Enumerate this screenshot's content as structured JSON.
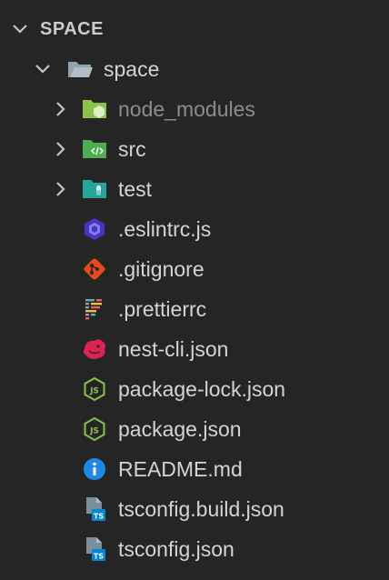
{
  "explorer": {
    "section_title": "SPACE",
    "root_folder": {
      "name": "space",
      "icon": "folder-open-icon",
      "expanded": true
    },
    "items": [
      {
        "name": "node_modules",
        "type": "folder",
        "icon": "nodejs-folder-icon",
        "expanded": false,
        "dimmed": true
      },
      {
        "name": "src",
        "type": "folder",
        "icon": "src-folder-icon",
        "expanded": false,
        "dimmed": false
      },
      {
        "name": "test",
        "type": "folder",
        "icon": "test-folder-icon",
        "expanded": false,
        "dimmed": false
      },
      {
        "name": ".eslintrc.js",
        "type": "file",
        "icon": "eslint-icon"
      },
      {
        "name": ".gitignore",
        "type": "file",
        "icon": "git-icon"
      },
      {
        "name": ".prettierrc",
        "type": "file",
        "icon": "prettier-icon"
      },
      {
        "name": "nest-cli.json",
        "type": "file",
        "icon": "nestjs-icon"
      },
      {
        "name": "package-lock.json",
        "type": "file",
        "icon": "nodejs-icon"
      },
      {
        "name": "package.json",
        "type": "file",
        "icon": "nodejs-icon"
      },
      {
        "name": "README.md",
        "type": "file",
        "icon": "info-icon"
      },
      {
        "name": "tsconfig.build.json",
        "type": "file",
        "icon": "tsconfig-icon"
      },
      {
        "name": "tsconfig.json",
        "type": "file",
        "icon": "tsconfig-icon"
      }
    ]
  },
  "colors": {
    "background": "#252526",
    "text": "#d4d4d4",
    "text_dimmed": "#8c8c8c",
    "chevron": "#c5c5c5",
    "folder_gray": "#90a4ae",
    "node_green": "#8bc34a",
    "src_green": "#4caf50",
    "test_teal": "#26a69a",
    "eslint_purple": "#4b32c3",
    "git_orange": "#e64a19",
    "nest_red": "#e0234e",
    "info_blue": "#1e88e5",
    "ts_blue": "#0288d1"
  }
}
